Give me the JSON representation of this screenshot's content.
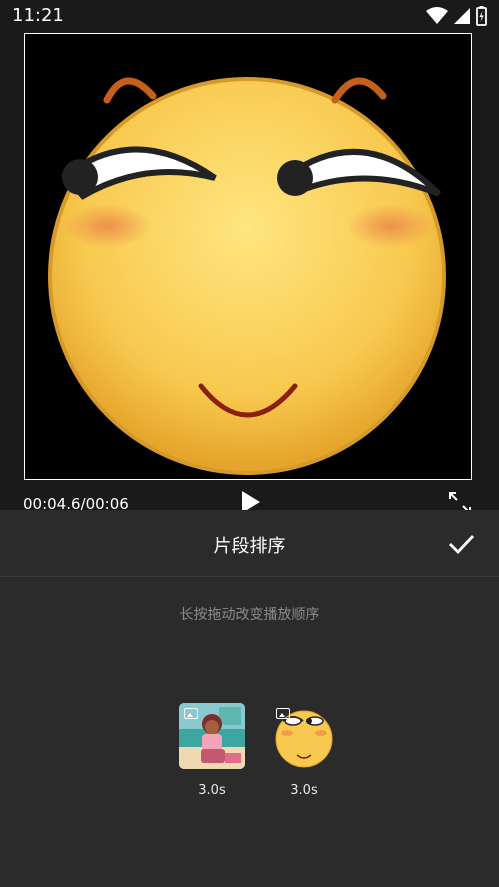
{
  "status_bar": {
    "time": "11:21"
  },
  "player": {
    "time_readout": "00:04.6/00:06"
  },
  "sheet": {
    "title": "片段排序",
    "hint": "长按拖动改变播放顺序",
    "clips": [
      {
        "duration": "3.0s",
        "thumb": "cartoon-girl-image"
      },
      {
        "duration": "3.0s",
        "thumb": "smiley-emoji-image"
      }
    ]
  },
  "colors": {
    "background": "#1a1a1a",
    "sheet": "#2b2b2b",
    "hint_text": "#8a8a8a"
  },
  "icons": [
    "wifi-icon",
    "signal-icon",
    "battery-icon",
    "play-icon",
    "fullscreen-exit-icon",
    "check-icon",
    "image-badge-icon"
  ]
}
